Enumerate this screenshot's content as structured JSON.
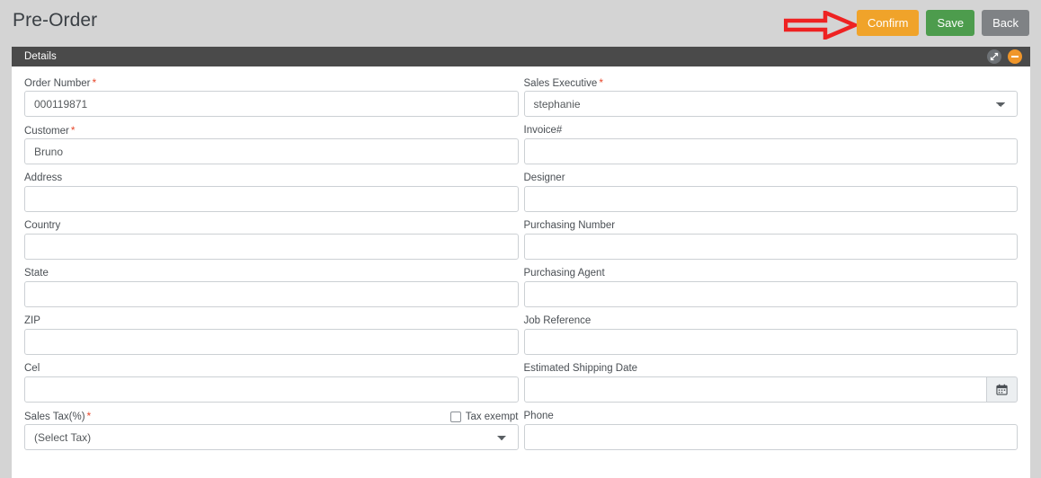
{
  "header": {
    "title": "Pre-Order",
    "buttons": [
      {
        "label": "Confirm",
        "name": "confirm-button",
        "color": "#f0a32a"
      },
      {
        "label": "Save",
        "name": "save-button",
        "color": "#4d9c4d"
      },
      {
        "label": "Back",
        "name": "back-button",
        "color": "#7f8285"
      }
    ],
    "annotation": {
      "type": "red-arrow",
      "points_to": "Confirm",
      "color": "#ee2222"
    }
  },
  "panel": {
    "title": "Details",
    "icons": [
      {
        "name": "resize-icon",
        "color": "#6e7276"
      },
      {
        "name": "collapse-minus-icon",
        "color": "#f0962a"
      }
    ]
  },
  "form": {
    "left": [
      {
        "label": "Order Number",
        "required": true,
        "type": "text",
        "value": "000119871",
        "placeholder": ""
      },
      {
        "label": "Customer",
        "required": true,
        "type": "text",
        "value": "Bruno",
        "placeholder": ""
      },
      {
        "label": "Address",
        "required": false,
        "type": "text",
        "value": "",
        "placeholder": ""
      },
      {
        "label": "Country",
        "required": false,
        "type": "text",
        "value": "",
        "placeholder": ""
      },
      {
        "label": "State",
        "required": false,
        "type": "text",
        "value": "",
        "placeholder": ""
      },
      {
        "label": "ZIP",
        "required": false,
        "type": "text",
        "value": "",
        "placeholder": ""
      },
      {
        "label": "Cel",
        "required": false,
        "type": "text",
        "value": "",
        "placeholder": ""
      },
      {
        "label": "Sales Tax(%)",
        "required": true,
        "type": "select",
        "value": "(Select Tax)",
        "placeholder": "",
        "checkbox": {
          "label": "Tax exempt",
          "checked": false
        }
      }
    ],
    "right": [
      {
        "label": "Sales Executive",
        "required": true,
        "type": "select",
        "value": "stephanie",
        "placeholder": ""
      },
      {
        "label": "Invoice#",
        "required": false,
        "type": "text",
        "value": "",
        "placeholder": ""
      },
      {
        "label": "Designer",
        "required": false,
        "type": "text",
        "value": "",
        "placeholder": ""
      },
      {
        "label": "Purchasing Number",
        "required": false,
        "type": "text",
        "value": "",
        "placeholder": ""
      },
      {
        "label": "Purchasing Agent",
        "required": false,
        "type": "text",
        "value": "",
        "placeholder": ""
      },
      {
        "label": "Job Reference",
        "required": false,
        "type": "text",
        "value": "",
        "placeholder": ""
      },
      {
        "label": "Estimated Shipping Date",
        "required": false,
        "type": "date",
        "value": "",
        "placeholder": "",
        "addon": "calendar-icon"
      },
      {
        "label": "Phone",
        "required": false,
        "type": "text",
        "value": "",
        "placeholder": ""
      }
    ]
  }
}
